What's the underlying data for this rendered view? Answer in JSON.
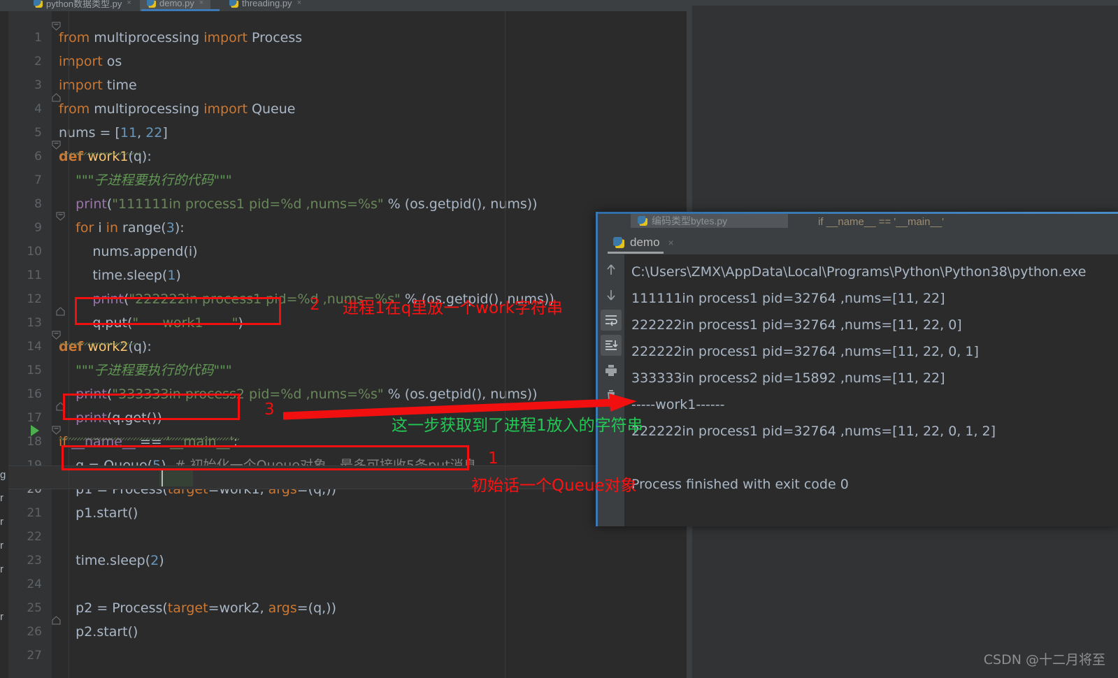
{
  "editor": {
    "tabs": [
      {
        "label": "python数据类型.py",
        "active": false
      },
      {
        "label": "demo.py",
        "active": true
      },
      {
        "label": "threading.py",
        "active": false
      }
    ],
    "gutter_edge_chars": [
      "g",
      "r",
      "r",
      "r",
      "r",
      "r"
    ],
    "lines": [
      {
        "n": "1",
        "fold": "minus-top",
        "segs": [
          {
            "t": "from ",
            "c": "kw"
          },
          {
            "t": "multiprocessing ",
            "c": "pl"
          },
          {
            "t": "import ",
            "c": "kw"
          },
          {
            "t": "Process",
            "c": "pl"
          }
        ]
      },
      {
        "n": "2",
        "fold": "",
        "segs": [
          {
            "t": "import ",
            "c": "kw"
          },
          {
            "t": "os",
            "c": "pl"
          }
        ]
      },
      {
        "n": "3",
        "fold": "",
        "segs": [
          {
            "t": "import ",
            "c": "kw"
          },
          {
            "t": "time",
            "c": "pl"
          }
        ]
      },
      {
        "n": "4",
        "fold": "minus-end",
        "segs": [
          {
            "t": "from ",
            "c": "kw"
          },
          {
            "t": "multiprocessing ",
            "c": "pl"
          },
          {
            "t": "import ",
            "c": "kw"
          },
          {
            "t": "Queue",
            "c": "pl"
          }
        ]
      },
      {
        "n": "5",
        "fold": "",
        "segs": [
          {
            "t": "nums ",
            "c": "pl"
          },
          {
            "t": "= ",
            "c": "pl"
          },
          {
            "t": "[",
            "c": "pl"
          },
          {
            "t": "11",
            "c": "num"
          },
          {
            "t": ", ",
            "c": "pl"
          },
          {
            "t": "22",
            "c": "num"
          },
          {
            "t": "]",
            "c": "pl"
          }
        ]
      },
      {
        "n": "6",
        "fold": "minus-top",
        "segs": [
          {
            "t": "def ",
            "c": "def"
          },
          {
            "t": "work1",
            "c": "fn"
          },
          {
            "t": "(q):",
            "c": "pl"
          }
        ]
      },
      {
        "n": "7",
        "fold": "",
        "segs": [
          {
            "t": "    \"\"\"子进程要执行的代码\"\"\"",
            "c": "doc"
          }
        ]
      },
      {
        "n": "8",
        "fold": "",
        "segs": [
          {
            "t": "    ",
            "c": "pl"
          },
          {
            "t": "print",
            "c": "viol"
          },
          {
            "t": "(",
            "c": "pl"
          },
          {
            "t": "\"111111in process1 pid=%d ,nums=%s\"",
            "c": "str"
          },
          {
            "t": " % (os.getpid(), nums))",
            "c": "pl"
          }
        ]
      },
      {
        "n": "9",
        "fold": "minus-top2",
        "segs": [
          {
            "t": "    ",
            "c": "pl"
          },
          {
            "t": "for ",
            "c": "kw"
          },
          {
            "t": "i ",
            "c": "pl"
          },
          {
            "t": "in ",
            "c": "kw"
          },
          {
            "t": "range(",
            "c": "pl"
          },
          {
            "t": "3",
            "c": "num"
          },
          {
            "t": "):",
            "c": "pl"
          }
        ]
      },
      {
        "n": "10",
        "fold": "",
        "segs": [
          {
            "t": "        nums.append(i)",
            "c": "pl"
          }
        ]
      },
      {
        "n": "11",
        "fold": "",
        "segs": [
          {
            "t": "        time.sleep(",
            "c": "pl"
          },
          {
            "t": "1",
            "c": "num"
          },
          {
            "t": ")",
            "c": "pl"
          }
        ]
      },
      {
        "n": "12",
        "fold": "",
        "segs": [
          {
            "t": "        ",
            "c": "pl"
          },
          {
            "t": "print",
            "c": "viol"
          },
          {
            "t": "(",
            "c": "pl"
          },
          {
            "t": "\"222222in process1 pid=%d ,nums=%s\"",
            "c": "str"
          },
          {
            "t": " % (os.getpid(), nums))",
            "c": "pl"
          }
        ]
      },
      {
        "n": "13",
        "fold": "minus-end2",
        "segs": [
          {
            "t": "        q.put(",
            "c": "pl"
          },
          {
            "t": "\"-----work1------\"",
            "c": "str"
          },
          {
            "t": ")",
            "c": "pl"
          }
        ]
      },
      {
        "n": "14",
        "fold": "minus-top",
        "segs": [
          {
            "t": "def ",
            "c": "def"
          },
          {
            "t": "work2",
            "c": "fn"
          },
          {
            "t": "(q):",
            "c": "pl"
          }
        ]
      },
      {
        "n": "15",
        "fold": "",
        "segs": [
          {
            "t": "    \"\"\"子进程要执行的代码\"\"\"",
            "c": "doc"
          }
        ]
      },
      {
        "n": "16",
        "fold": "",
        "segs": [
          {
            "t": "    ",
            "c": "pl"
          },
          {
            "t": "print",
            "c": "viol"
          },
          {
            "t": "(",
            "c": "pl"
          },
          {
            "t": "\"333333in process2 pid=%d ,nums=%s\"",
            "c": "str"
          },
          {
            "t": " % (os.getpid(), nums))",
            "c": "pl"
          }
        ]
      },
      {
        "n": "17",
        "fold": "minus-end2",
        "segs": [
          {
            "t": "    ",
            "c": "pl"
          },
          {
            "t": "print",
            "c": "viol"
          },
          {
            "t": "(q.get())",
            "c": "pl"
          }
        ]
      },
      {
        "n": "18",
        "fold": "minus-top",
        "run": true,
        "segs": [
          {
            "t": "if ",
            "c": "kw"
          },
          {
            "t": "__name__ ",
            "c": "viol"
          },
          {
            "t": "== ",
            "c": "pl"
          },
          {
            "t": "'__main__'",
            "c": "str"
          },
          {
            "t": ":",
            "c": "pl"
          }
        ]
      },
      {
        "n": "19",
        "fold": "",
        "segs": [
          {
            "t": "    q = Queue(",
            "c": "pl"
          },
          {
            "t": "5",
            "c": "num"
          },
          {
            "t": ")  ",
            "c": "pl"
          },
          {
            "t": "# 初始化一个Queue对象，最多可接收5条put消息",
            "c": "cmt"
          }
        ]
      },
      {
        "n": "20",
        "fold": "",
        "current": true,
        "segs": [
          {
            "t": "    p1 = Process(",
            "c": "pl"
          },
          {
            "t": "target",
            "c": "kw"
          },
          {
            "t": "=work1, ",
            "c": "pl"
          },
          {
            "t": "args",
            "c": "kw"
          },
          {
            "t": "=(q,))",
            "c": "pl"
          }
        ]
      },
      {
        "n": "21",
        "fold": "",
        "segs": [
          {
            "t": "    p1.start()",
            "c": "pl"
          }
        ]
      },
      {
        "n": "22",
        "fold": "",
        "segs": [
          {
            "t": "",
            "c": "pl"
          }
        ]
      },
      {
        "n": "23",
        "fold": "",
        "segs": [
          {
            "t": "    time.sleep(",
            "c": "pl"
          },
          {
            "t": "2",
            "c": "num"
          },
          {
            "t": ")",
            "c": "pl"
          }
        ]
      },
      {
        "n": "24",
        "fold": "",
        "segs": [
          {
            "t": "",
            "c": "pl"
          }
        ]
      },
      {
        "n": "25",
        "fold": "",
        "segs": [
          {
            "t": "    p2 = Process(",
            "c": "pl"
          },
          {
            "t": "target",
            "c": "kw"
          },
          {
            "t": "=work2, ",
            "c": "pl"
          },
          {
            "t": "args",
            "c": "kw"
          },
          {
            "t": "=(q,))",
            "c": "pl"
          }
        ]
      },
      {
        "n": "26",
        "fold": "minus-end",
        "segs": [
          {
            "t": "    p2.start()",
            "c": "pl"
          }
        ]
      },
      {
        "n": "27",
        "fold": "",
        "segs": [
          {
            "t": "",
            "c": "pl"
          }
        ]
      }
    ]
  },
  "run_window": {
    "hidden_tab_label": "编码类型bytes.py",
    "breadcrumb": "if __name__ == '__main__'",
    "console_tab_label": "demo",
    "console_tab_close": "×",
    "toolbar_icons": [
      "arrow-up-icon",
      "arrow-down-icon",
      "soft-wrap-icon",
      "scroll-to-end-icon",
      "print-icon",
      "trash-icon"
    ],
    "output_lines": [
      {
        "text": "C:\\Users\\ZMX\\AppData\\Local\\Programs\\Python\\Python38\\python.exe ",
        "style": "gray"
      },
      {
        "text": "111111in process1 pid=32764 ,nums=[11, 22]",
        "style": "gray"
      },
      {
        "text": "222222in process1 pid=32764 ,nums=[11, 22, 0]",
        "style": "gray"
      },
      {
        "text": "222222in process1 pid=32764 ,nums=[11, 22, 0, 1]",
        "style": "gray"
      },
      {
        "text": "333333in process2 pid=15892 ,nums=[11, 22]",
        "style": "gray"
      },
      {
        "text": "-----work1------",
        "style": "gray"
      },
      {
        "text": "222222in process1 pid=32764 ,nums=[11, 22, 0, 1, 2]",
        "style": "gray"
      },
      {
        "text": "",
        "style": "gray"
      },
      {
        "text": "Process finished with exit code 0",
        "style": "gray"
      }
    ]
  },
  "annotations": {
    "colors": {
      "red": "#f10f0f",
      "green": "#22c955"
    },
    "num_2": "2",
    "num_3": "3",
    "num_1": "1",
    "red_text_2": "进程1在q里放一个work字符串",
    "red_text_1": "初始话一个Queue对象",
    "green_text": "这一步获取到了进程1放入的字符串"
  },
  "watermark": "CSDN @十二月将至"
}
